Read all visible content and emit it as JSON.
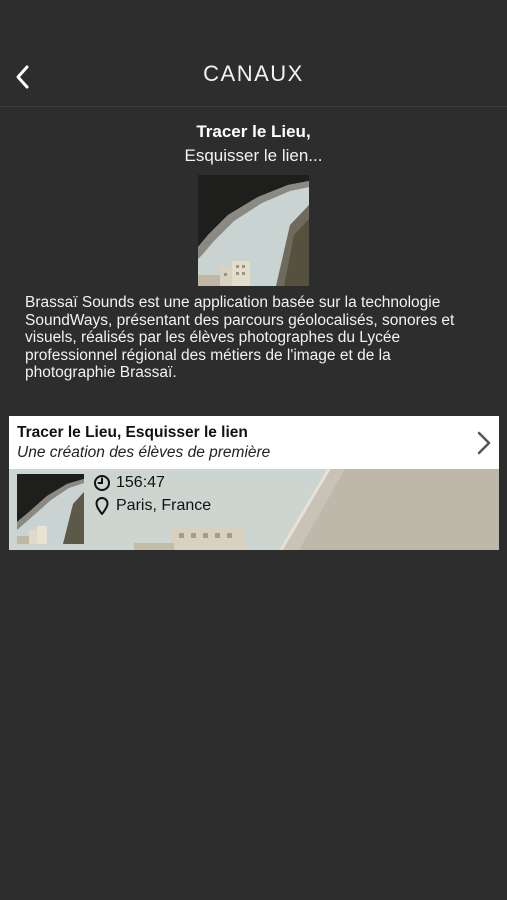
{
  "header": {
    "back_icon": "chevron-left-icon",
    "title": "CANAUX"
  },
  "intro": {
    "title": "Tracer le Lieu,",
    "subtitle": "Esquisser le lien...",
    "description": "Brassaï Sounds est une application basée sur la technologie SoundWays, présentant des parcours géolocalisés, sonores et visuels, réalisés par les élèves photographes du Lycée professionnel régional des métiers de l'image et de la photographie Brassaï."
  },
  "card": {
    "title": "Tracer le Lieu, Esquisser le lien",
    "subtitle": "Une création des élèves de première",
    "duration": "156:47",
    "location": "Paris, France",
    "chevron_icon": "chevron-right-icon",
    "duration_icon": "clock-icon",
    "location_icon": "location-pin-icon"
  },
  "colors": {
    "background": "#2d2d2d",
    "card_header": "#ffffff",
    "sky": "#cfd6d1"
  }
}
